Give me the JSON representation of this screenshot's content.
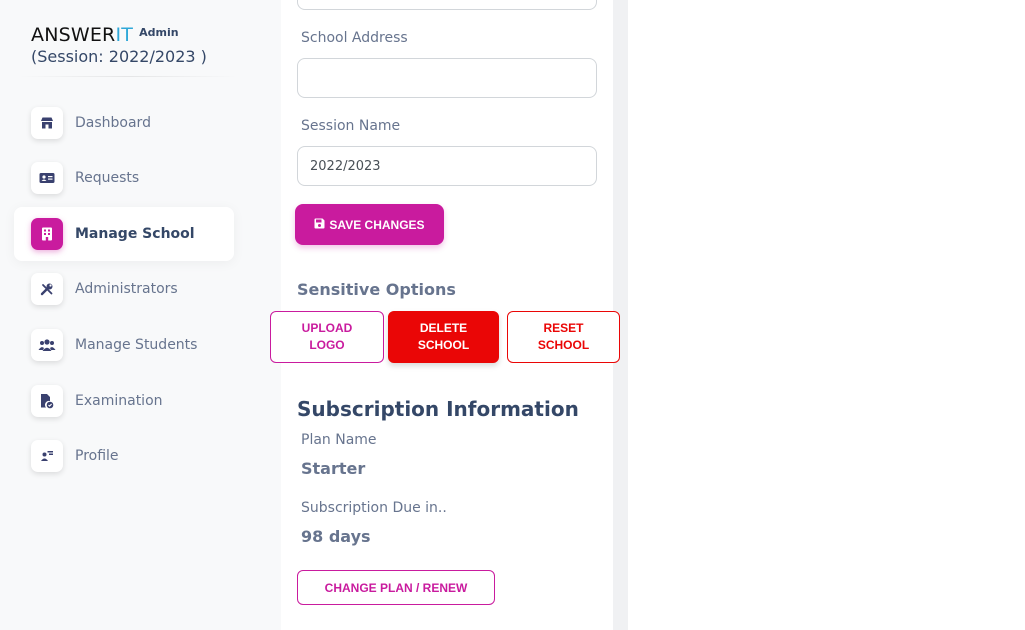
{
  "brand": {
    "name_main": "ANSWER",
    "name_accent": "IT",
    "role": "Admin",
    "session": "(Session: 2022/2023 )"
  },
  "sidebar": {
    "items": [
      {
        "label": "Dashboard",
        "icon": "store-icon",
        "active": false
      },
      {
        "label": "Requests",
        "icon": "id-card-icon",
        "active": false
      },
      {
        "label": "Manage School",
        "icon": "building-icon",
        "active": true
      },
      {
        "label": "Administrators",
        "icon": "tools-icon",
        "active": false
      },
      {
        "label": "Manage Students",
        "icon": "users-icon",
        "active": false
      },
      {
        "label": "Examination",
        "icon": "file-check-icon",
        "active": false
      },
      {
        "label": "Profile",
        "icon": "user-profile-icon",
        "active": false
      }
    ]
  },
  "form": {
    "school_address_label": "School Address",
    "school_address_value": "",
    "session_name_label": "Session Name",
    "session_name_value": "2022/2023",
    "save_label": "SAVE CHANGES"
  },
  "sensitive": {
    "title": "Sensitive Options",
    "upload_line1": "UPLOAD",
    "upload_line2": "LOGO",
    "delete_line1": "DELETE",
    "delete_line2": "SCHOOL",
    "reset_line1": "RESET",
    "reset_line2": "SCHOOL"
  },
  "subscription": {
    "title": "Subscription Information",
    "plan_label": "Plan Name",
    "plan_value": "Starter",
    "due_label": "Subscription Due in..",
    "due_value": "98 days",
    "change_label": "CHANGE PLAN / RENEW"
  },
  "colors": {
    "primary": "#c91b9e",
    "danger": "#ea0606",
    "accent_it": "#2fa8d8",
    "text_muted": "#67748e",
    "text_dark": "#344767"
  }
}
